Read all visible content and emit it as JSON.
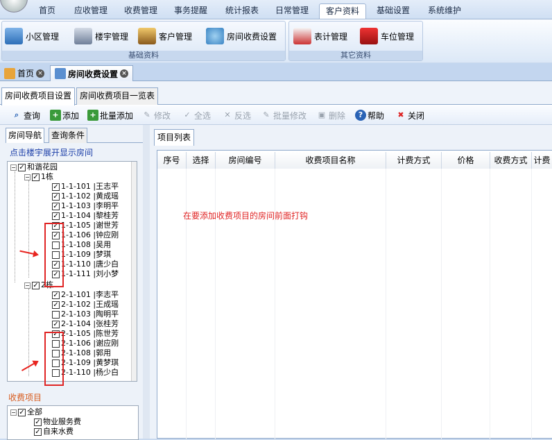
{
  "menubar": {
    "items": [
      "首页",
      "应收管理",
      "收费管理",
      "事务提醒",
      "统计报表",
      "日常管理",
      "客户资料",
      "基础设置",
      "系统维护"
    ],
    "active": "客户资料"
  },
  "ribbon": {
    "basic": {
      "label": "基础资料",
      "buttons": [
        "小区管理",
        "楼宇管理",
        "客户管理",
        "房间收费设置"
      ]
    },
    "other": {
      "label": "其它资料",
      "buttons": [
        "表计管理",
        "车位管理"
      ]
    }
  },
  "doctabs": [
    "首页",
    "房间收费设置"
  ],
  "subtabs": [
    "房间收费项目设置",
    "房间收费项目一览表"
  ],
  "toolbar": [
    {
      "label": "查询",
      "icon": "search-icon",
      "enabled": true
    },
    {
      "label": "添加",
      "icon": "add-icon",
      "enabled": true
    },
    {
      "label": "批量添加",
      "icon": "batch-add-icon",
      "enabled": true
    },
    {
      "label": "修改",
      "icon": "edit-icon",
      "enabled": false
    },
    {
      "label": "全选",
      "icon": "check-all-icon",
      "enabled": false
    },
    {
      "label": "反选",
      "icon": "invert-icon",
      "enabled": false
    },
    {
      "label": "批量修改",
      "icon": "batch-edit-icon",
      "enabled": false
    },
    {
      "label": "删除",
      "icon": "delete-icon",
      "enabled": false
    },
    {
      "label": "帮助",
      "icon": "help-icon",
      "enabled": true
    },
    {
      "label": "关闭",
      "icon": "close-icon",
      "enabled": true
    }
  ],
  "left": {
    "tabs": [
      "房间导航",
      "查询条件"
    ],
    "hint": "点击楼宇展开显示房间",
    "tree": {
      "root": "和谐花园",
      "buildings": [
        {
          "label": "1栋",
          "rooms": [
            {
              "label": "1-1-101 |王志平",
              "checked": true
            },
            {
              "label": "1-1-102 |黄成瑶",
              "checked": true
            },
            {
              "label": "1-1-103 |李明平",
              "checked": true
            },
            {
              "label": "1-1-104 |黎桂芳",
              "checked": true
            },
            {
              "label": "1-1-105 |谢世芳",
              "checked": true
            },
            {
              "label": "1-1-106 |钟应刚",
              "checked": true
            },
            {
              "label": "1-1-108 |吴用",
              "checked": false
            },
            {
              "label": "1-1-109 |梦琪",
              "checked": false
            },
            {
              "label": "1-1-110 |唐少白",
              "checked": true
            },
            {
              "label": "1-1-111 |刘小梦",
              "checked": true
            }
          ]
        },
        {
          "label": "2栋",
          "rooms": [
            {
              "label": "2-1-101 |李志平",
              "checked": true
            },
            {
              "label": "2-1-102 |王成瑶",
              "checked": true
            },
            {
              "label": "2-1-103 |陶明平",
              "checked": false
            },
            {
              "label": "2-1-104 |张桂芳",
              "checked": true
            },
            {
              "label": "2-1-105 |陈世芳",
              "checked": true
            },
            {
              "label": "2-1-106 |谢应刚",
              "checked": false
            },
            {
              "label": "2-1-108 |郭用",
              "checked": false
            },
            {
              "label": "2-1-109 |黄梦琪",
              "checked": false
            },
            {
              "label": "2-1-110 |杨少白",
              "checked": false
            }
          ]
        }
      ]
    },
    "fee_label": "收费项目",
    "fee_tree": {
      "root": "全部",
      "items": [
        "物业服务费",
        "自来水费"
      ]
    }
  },
  "right": {
    "tab": "项目列表",
    "columns": [
      "序号",
      "选择",
      "房间编号",
      "收费项目名称",
      "计费方式",
      "价格",
      "收费方式",
      "计费"
    ],
    "annotation": "在要添加收费项目的房间前面打钩"
  }
}
